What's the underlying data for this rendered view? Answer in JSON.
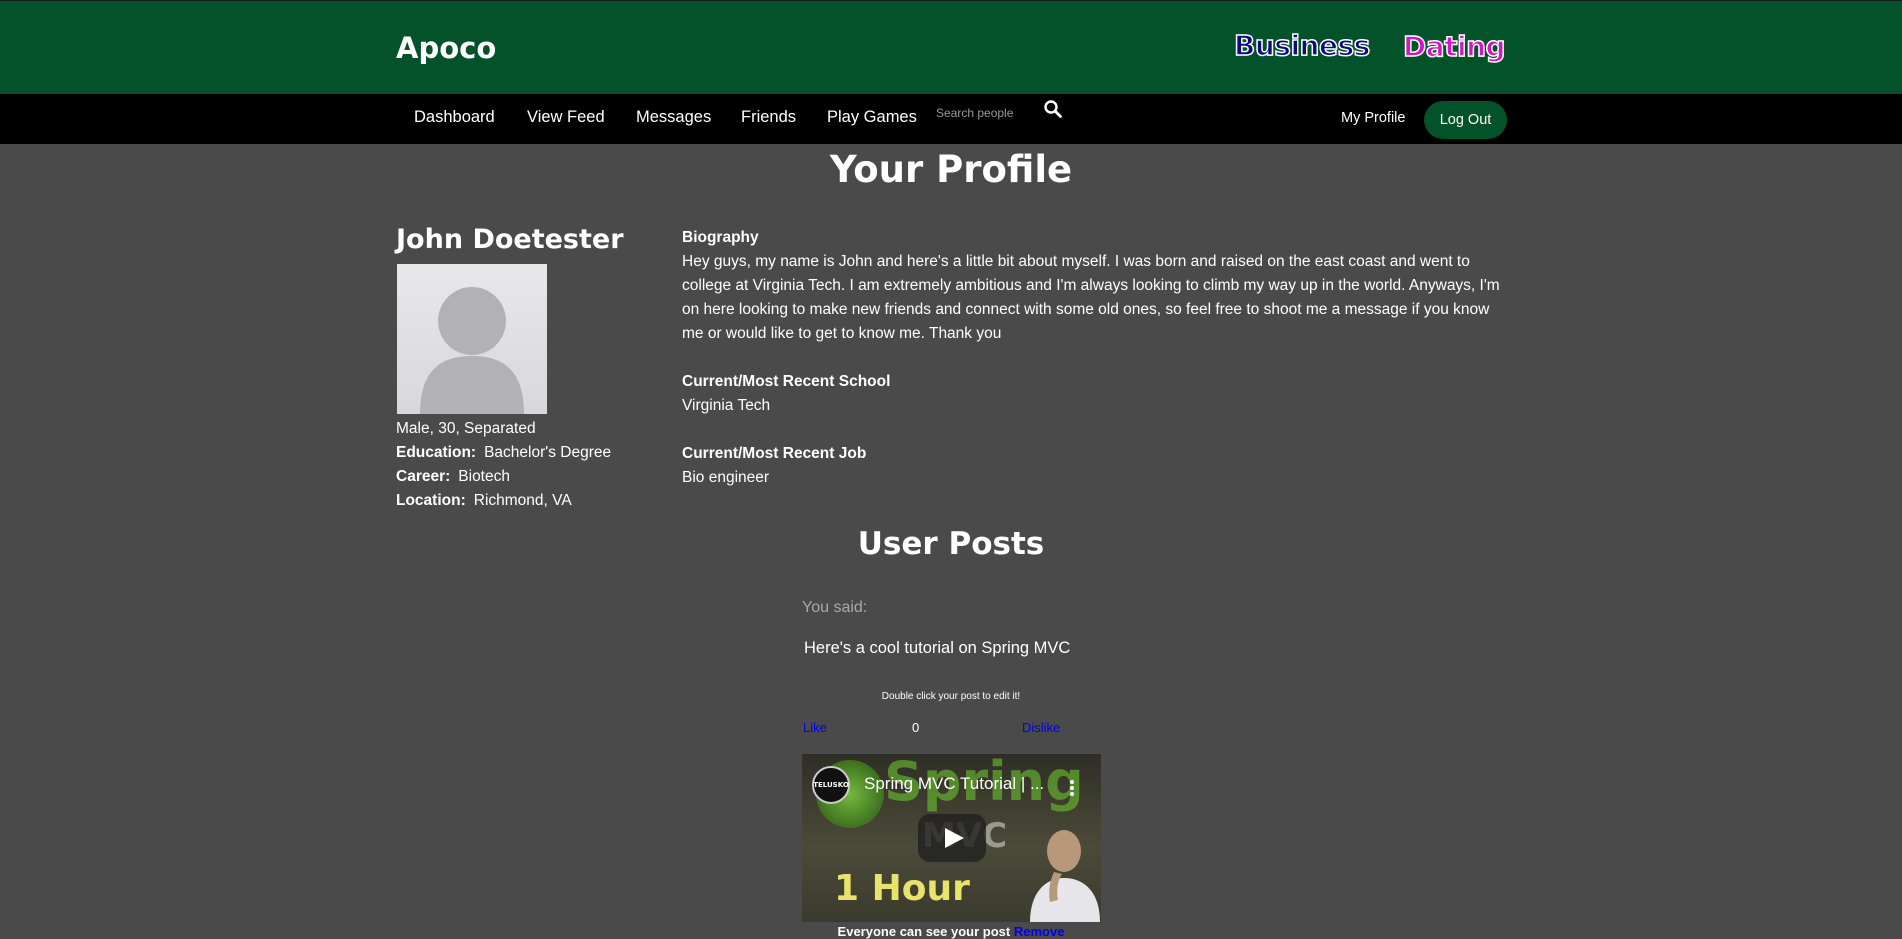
{
  "header": {
    "brand": "Apoco",
    "mode_business": "Business",
    "mode_dating": "Dating",
    "background_color": "#03522a"
  },
  "nav": {
    "items": [
      {
        "label": "Dashboard"
      },
      {
        "label": "View Feed"
      },
      {
        "label": "Messages"
      },
      {
        "label": "Friends"
      },
      {
        "label": "Play Games"
      }
    ],
    "search_placeholder": "Search people",
    "search_icon": "search-icon",
    "my_profile": "My Profile",
    "logout": "Log Out"
  },
  "page": {
    "title": "Your Profile"
  },
  "profile": {
    "name": "John Doetester",
    "avatar_icon": "default-avatar",
    "summary": "Male, 30, Separated",
    "education_label": "Education:",
    "education": "Bachelor's Degree",
    "career_label": "Career:",
    "career": "Biotech",
    "location_label": "Location:",
    "location": "Richmond, VA",
    "bio_heading": "Biography",
    "bio": "Hey guys, my name is John and here's a little bit about myself. I was born and raised on the east coast and went to college at Virginia Tech. I am extremely ambitious and I'm always looking to climb my way up in the world. Anyways, I'm on here looking to make new friends and connect with some old ones, so feel free to shoot me a message if you know me or would like to get to know me. Thank you",
    "school_heading": "Current/Most Recent School",
    "school": "Virginia Tech",
    "job_heading": "Current/Most Recent Job",
    "job": "Bio engineer"
  },
  "posts": {
    "title": "User Posts",
    "items": [
      {
        "author": "You said:",
        "text": "Here's a cool tutorial on Spring MVC",
        "hint": "Double click your post to edit it!",
        "like": "Like",
        "count": "0",
        "dislike": "Dislike",
        "video": {
          "title": "Spring MVC Tutorial | ...",
          "channel_badge": "TELUSKO",
          "thumb_big": "Spring",
          "thumb_sub": "MVC",
          "thumb_duration": "1 Hour"
        },
        "visibility": "Everyone can see your post",
        "remove": "Remove"
      }
    ]
  }
}
